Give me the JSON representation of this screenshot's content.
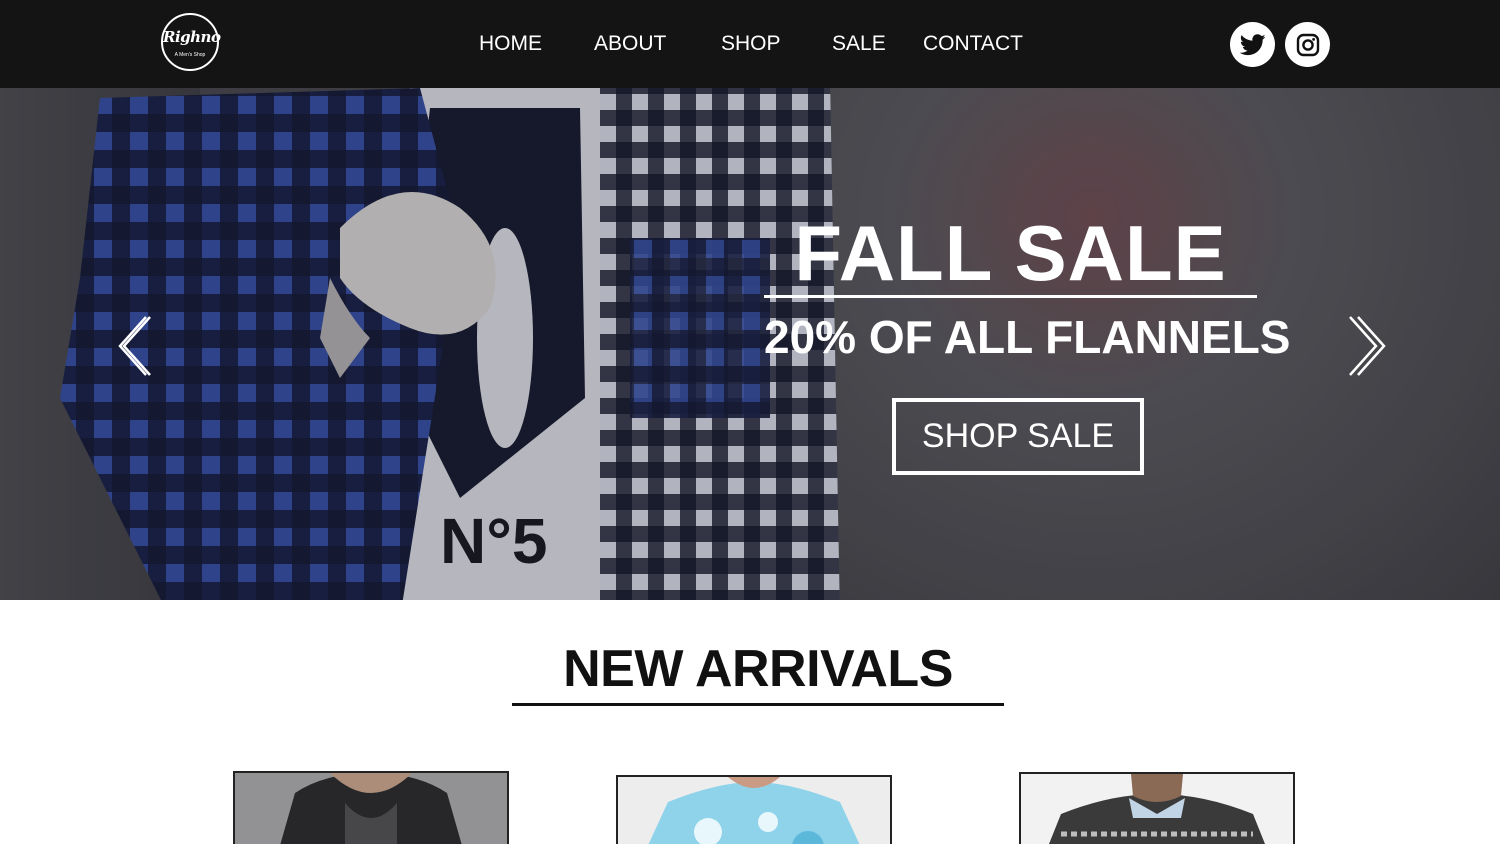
{
  "brand": {
    "logo_script": "Righno",
    "logo_tagline": "A Men's Shop"
  },
  "nav": {
    "links": [
      "HOME",
      "ABOUT",
      "SHOP",
      "SALE",
      "CONTACT"
    ]
  },
  "social": {
    "icons": [
      "twitter-icon",
      "instagram-icon"
    ]
  },
  "hero": {
    "title": "FALL SALE",
    "subtitle": "20% OF ALL FLANNELS",
    "button_label": "SHOP SALE",
    "shirt_print": "N°5",
    "prev_icon": "chevron-left-icon",
    "next_icon": "chevron-right-icon"
  },
  "new_arrivals": {
    "title": "NEW ARRIVALS",
    "products": [
      {
        "image": "hooded-jacket-photo"
      },
      {
        "image": "tie-dye-shirt-photo"
      },
      {
        "image": "patterned-sweater-photo"
      }
    ]
  },
  "colors": {
    "nav_bg": "#141414",
    "hero_text": "#ffffff",
    "flannel_blue": "#283e8c",
    "flannel_dark": "#10142a"
  }
}
